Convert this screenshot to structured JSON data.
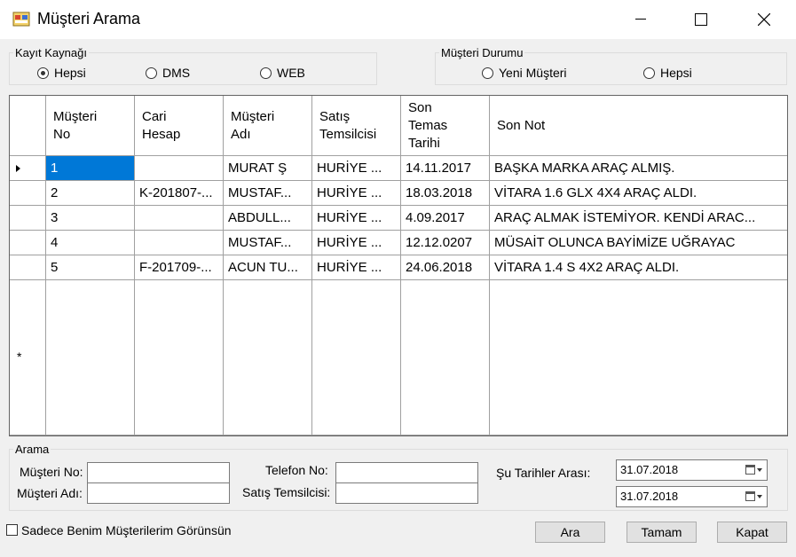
{
  "window": {
    "title": "Müşteri Arama",
    "icon": "app-icon"
  },
  "kaynak": {
    "legend": "Kayıt Kaynağı",
    "options": [
      {
        "label": "Hepsi",
        "selected": true
      },
      {
        "label": "DMS",
        "selected": false
      },
      {
        "label": "WEB",
        "selected": false
      }
    ]
  },
  "durum": {
    "legend": "Müşteri Durumu",
    "options": [
      {
        "label": "Yeni Müşteri",
        "selected": false
      },
      {
        "label": "Hepsi",
        "selected": false
      }
    ]
  },
  "grid": {
    "columns": [
      "Müşteri\nNo",
      "Cari\nHesap",
      "Müşteri\nAdı",
      "Satış\nTemsilcisi",
      "Son\nTemas\nTarihi",
      "Son Not"
    ],
    "rows": [
      [
        "1",
        "",
        "MURAT Ş",
        "HURİYE ...",
        "14.11.2017",
        "BAŞKA MARKA ARAÇ ALMIŞ."
      ],
      [
        "2",
        "K-201807-...",
        "MUSTAF...",
        "HURİYE ...",
        "18.03.2018",
        "VİTARA 1.6 GLX 4X4 ARAÇ ALDI."
      ],
      [
        "3",
        "",
        "ABDULL...",
        "HURİYE ...",
        "4.09.2017",
        "ARAÇ ALMAK İSTEMİYOR. KENDİ ARAC..."
      ],
      [
        "4",
        "",
        "MUSTAF...",
        "HURİYE ...",
        "12.12.0207",
        "MÜSAİT OLUNCA BAYİMİZE UĞRAYAC"
      ],
      [
        "5",
        "F-201709-...",
        "ACUN TU...",
        "HURİYE ...",
        "24.06.2018",
        "VİTARA 1.4 S 4X2 ARAÇ ALDI."
      ]
    ],
    "selected_row": 0,
    "selected_col": 0,
    "new_row_marker": "*"
  },
  "arama": {
    "legend": "Arama",
    "musteri_no_label": "Müşteri No:",
    "musteri_adi_label": "Müşteri Adı:",
    "telefon_label": "Telefon No:",
    "temsilci_label": "Satış Temsilcisi:",
    "tarih_label": "Şu Tarihler Arası:",
    "tarih_baslangic": "31.07.2018",
    "tarih_bitis": "31.07.2018",
    "musteri_no_value": "",
    "musteri_adi_value": "",
    "telefon_value": "",
    "temsilci_value": ""
  },
  "footer": {
    "sadece_label": "Sadece Benim Müşterilerim Görünsün",
    "ara": "Ara",
    "tamam": "Tamam",
    "kapat": "Kapat"
  },
  "colors": {
    "selection": "#0078d7",
    "window_bg": "#f0f0f0"
  }
}
